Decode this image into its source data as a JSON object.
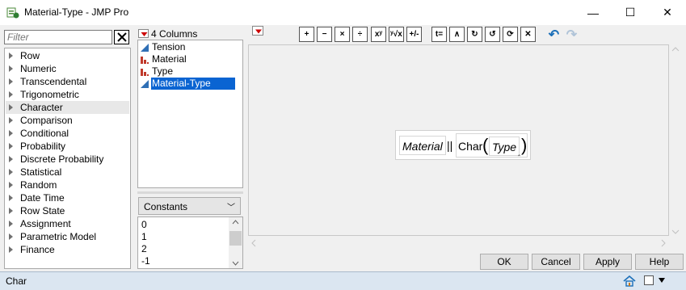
{
  "window": {
    "title": "Material-Type - JMP Pro",
    "minimize": "—",
    "maximize": "☐",
    "close": "✕"
  },
  "filter": {
    "placeholder": "Filter"
  },
  "functions": [
    "Row",
    "Numeric",
    "Transcendental",
    "Trigonometric",
    "Character",
    "Comparison",
    "Conditional",
    "Probability",
    "Discrete Probability",
    "Statistical",
    "Random",
    "Date Time",
    "Row State",
    "Assignment",
    "Parametric Model",
    "Finance"
  ],
  "columns": {
    "count_label": "4 Columns",
    "items": [
      {
        "label": "Tension",
        "type": "continuous"
      },
      {
        "label": "Material",
        "type": "nominal"
      },
      {
        "label": "Type",
        "type": "nominal"
      },
      {
        "label": "Material-Type",
        "type": "continuous"
      }
    ]
  },
  "constants": {
    "selected": "Constants",
    "items": [
      "0",
      "1",
      "2",
      "-1"
    ]
  },
  "toolbar": [
    "+",
    "−",
    "×",
    "÷",
    "xʸ",
    "ʸ√x",
    "+/-",
    "t=",
    "∧",
    "↻",
    "↺",
    "⟳",
    "✕",
    "↶",
    "↷"
  ],
  "formula": {
    "term1": "Material",
    "operator": "||",
    "func": "Char",
    "arg": "Type",
    "open_paren": "(",
    "close_paren": ")",
    "caret": "‸"
  },
  "buttons": {
    "ok": "OK",
    "cancel": "Cancel",
    "apply": "Apply",
    "help": "Help"
  },
  "status": {
    "text": "Char"
  },
  "colors": {
    "selection": "#0a64d2",
    "status_bg": "#dbe6f1",
    "continuous_icon": "#2f6fb5",
    "nominal_icon": "#c0392b"
  }
}
